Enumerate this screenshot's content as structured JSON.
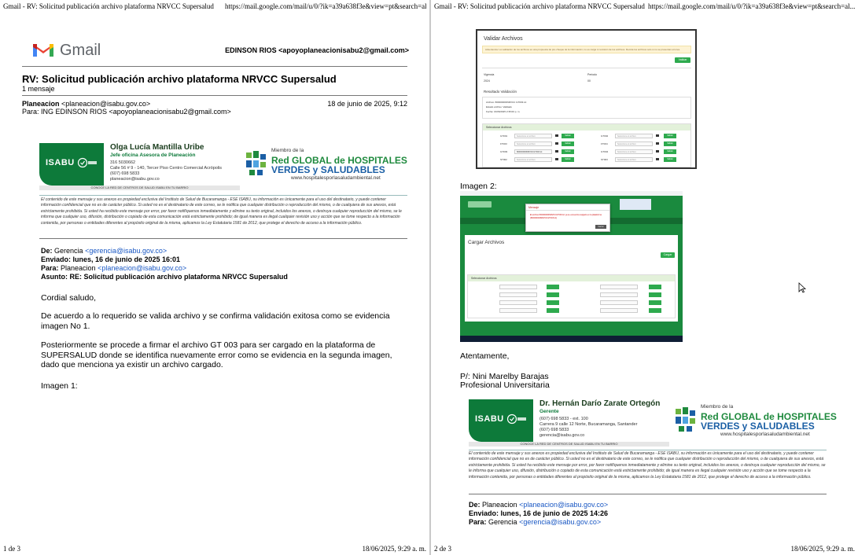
{
  "print": {
    "left_header_title": "Gmail - RV: Solicitud publicación archivo plataforma NRVCC Supersalud",
    "left_header_url": "https://mail.google.com/mail/u/0/?ik=a39a638f3e&view=pt&search=al...",
    "right_header_title": "Gmail - RV: Solicitud publicación archivo plataforma NRVCC Supersalud",
    "right_header_url": "https://mail.google.com/mail/u/0/?ik=a39a638f3e&view=pt&search=al...",
    "left_footer_page": "1 de 3",
    "left_footer_date": "18/06/2025, 9:29 a. m.",
    "right_footer_page": "2 de 3",
    "right_footer_date": "18/06/2025, 9:29 a. m."
  },
  "gmail": {
    "brand": "Gmail",
    "account": "EDINSON RIOS <apoyoplaneacionisabu2@gmail.com>"
  },
  "thread": {
    "subject": "RV: Solicitud publicación archivo plataforma NRVCC Supersalud",
    "count": "1 mensaje",
    "sender_name": "Planeacion",
    "sender_email": "<planeacion@isabu.gov.co>",
    "date": "18 de junio de 2025, 9:12",
    "to": "Para: ING EDINSON RIOS <apoyoplaneacionisabu2@gmail.com>"
  },
  "signature1": {
    "brand": "ISABU",
    "name": "Olga Lucía Mantilla Uribe",
    "role": "Jefe oficina Asesora de Planeación",
    "lines": [
      "316 5030662",
      "Calle 56 # 9 - 140, Tercer Piso Centro Comercial Acrópolis",
      "(607) 698 5833",
      "planeacion@isabu.gov.co"
    ],
    "strip": "CONOCE LA RED DE CENTROS DE SALUD ISABU EN TU BARRIO"
  },
  "signature2": {
    "brand": "ISABU",
    "name": "Dr. Hernán Darío Zarate Ortegón",
    "role": "Gerente",
    "lines": [
      "(607) 698 5833 - ext. 100",
      "Carrera 9 calle 12 Norte, Bucaramanga, Santander",
      "(607) 698 5833",
      "gerencia@isabu.gov.co"
    ],
    "strip": "CONOCE LA RED DE CENTROS DE SALUD ISABU EN TU BARRIO"
  },
  "network": {
    "small": "Miembro de la",
    "line1": "Red GLOBAL de HOSPITALES",
    "line2": "VERDES y SALUDABLES",
    "url": "www.hospitalesporlasaludambiental.net"
  },
  "disclaimer": "El contenido de este mensaje y sus anexos es propiedad exclusiva del Instituto de Salud de Bucaramanga - ESE ISABU, su información es únicamente para el uso del destinatario, y puede contener información confidencial que no es de carácter público. Si usted no es el destinatario de este correo, se le notifica que cualquier distribución o reproducción del mismo, o de cualquiera de sus anexos, está estrictamente prohibida. Si usted ha recibido este mensaje por error, por favor notifíquenos inmediatamente y elimine su texto original, incluidos los anexos, o destruya cualquier reproducción del mismo, se le informa que cualquier uso, difusión, distribución o copiado de esta comunicación está estrictamente prohibido; de igual manera es ilegal cualquier revisión uso y acción que se tome respecto a la información contenida, por personas o entidades diferentes al propósito original de la misma, aplicamos la Ley Estatutaria 1581 de 2012, que protege el derecho de acceso a la información público.",
  "forward1": {
    "de_label": "De:",
    "de_name": "Gerencia",
    "de_email": "<gerencia@isabu.gov.co>",
    "enviado": "Enviado: lunes, 16 de junio de 2025 16:01",
    "para_label": "Para:",
    "para_name": "Planeacion",
    "para_email": "<planeacion@isabu.gov.co>",
    "asunto": "Asunto: RE: Solicitud publicación archivo plataforma NRVCC Supersalud"
  },
  "body": {
    "greeting": "Cordial saludo,",
    "p1": "De acuerdo a lo requerido se valida archivo y se confirma validación exitosa como se evidencia imagen No 1.",
    "p2": "Posteriormente se procede a firmar el archivo GT 003 para ser cargado en la plataforma de SUPERSALUD donde se identifica nuevamente error como se evidencia en la segunda imagen, dado que menciona ya existir un archivo cargado.",
    "img1": "Imagen 1:",
    "img2": "Imagen 2:",
    "closing": "Atentamente,",
    "sign_name": "P/: Nini Marelby Barajas",
    "sign_role": "Profesional Universitaria"
  },
  "shot1": {
    "title": "Validar Archivos",
    "alert": "Advertencia: La validación de los archivos es una propuesta de pre-cheque de la información; no es carga ni remisión de los archivos. Remita los archivos solo si no se presentan errores.",
    "validate_btn": "Validar",
    "vigencia_label": "Vigencia",
    "vigencia_value": "2024",
    "periodo_label": "Periodo",
    "periodo_value": "00",
    "result_title": "Resultado Validación",
    "result_lines": [
      "Archivo: 800000000NRVCC GT003.txt",
      "Estado archivo: Validado",
      "Fecha: 16/06/2025 2:35:00 p. m."
    ],
    "panel_title": "Seleccionar Archivos",
    "placeholder": "Seleccione el archivo",
    "btn": "Validar",
    "rows": [
      {
        "code_l": "GT001",
        "file_l": "Seleccione el archivo",
        "code_r": "GT002",
        "file_r": "Seleccione el archivo"
      },
      {
        "code_l": "FT003",
        "file_l": "Seleccione el archivo",
        "code_r": "FT004",
        "file_r": "Seleccione el archivo"
      },
      {
        "code_l": "GT003",
        "file_l": "800000000NRVCCGT003.txt",
        "code_r": "GT004",
        "file_r": "Seleccione el archivo"
      },
      {
        "code_l": "ST002",
        "file_l": "Seleccione el archivo",
        "code_r": "ST003",
        "file_r": "Seleccione el archivo"
      }
    ]
  },
  "shot2": {
    "title": "Cargar Archivos",
    "modal_title": "Mensaje",
    "modal_msg": "El archivo 800000000NRVCCGT003.txt ya se encuentra cargado en la plataforma (800000000NRVCCGT003.txt)",
    "modal_btn": "Cerrar",
    "panel_title": "Seleccionar Archivos",
    "btn": "Cargar"
  },
  "forward2": {
    "de_label": "De:",
    "de_name": "Planeacion",
    "de_email": "<planeacion@isabu.gov.co>",
    "enviado": "Enviado: lunes, 16 de junio de 2025 14:26",
    "para_label": "Para:",
    "para_name": "Gerencia",
    "para_email": "<gerencia@isabu.gov.co>"
  },
  "colors": {
    "isabu_green": "#0d7a3a",
    "link_blue": "#1a58c4",
    "network_green": "#1f8a3e",
    "network_blue": "#1b5fa5"
  }
}
